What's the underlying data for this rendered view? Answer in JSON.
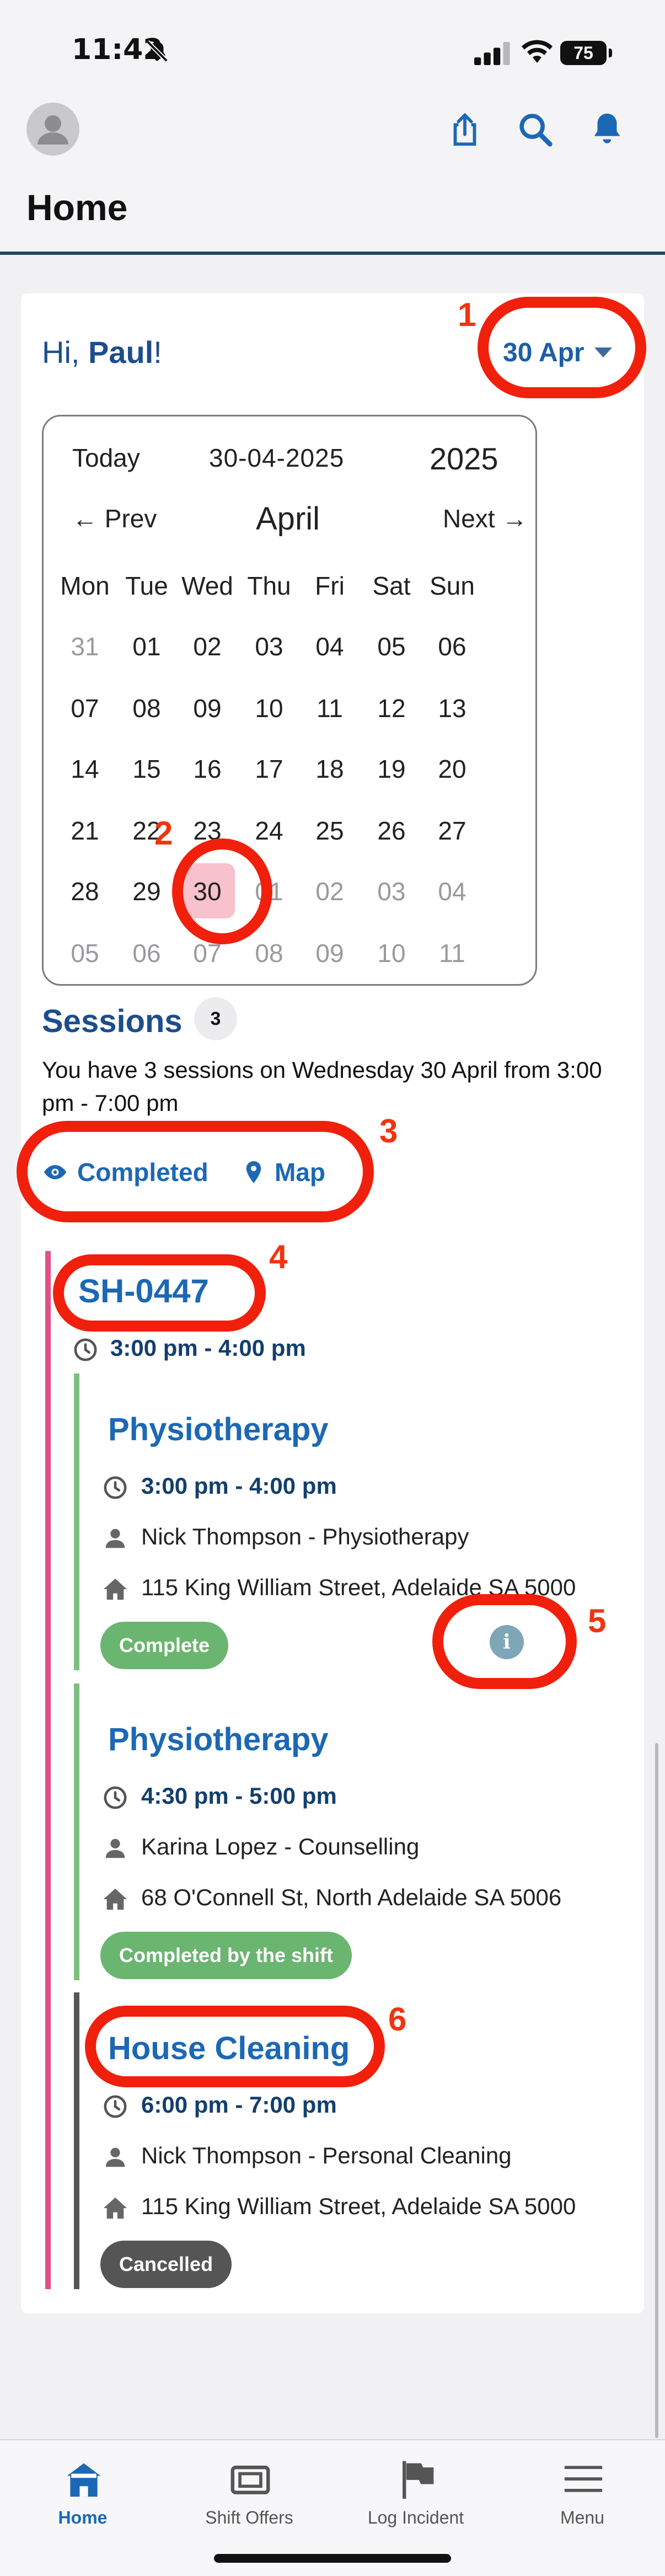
{
  "status_bar": {
    "time": "11:42",
    "battery": "75"
  },
  "header": {
    "title": "Home"
  },
  "greeting": {
    "prefix": "Hi, ",
    "name": "Paul",
    "suffix": "!"
  },
  "date_picker": {
    "label": "30 Apr"
  },
  "calendar": {
    "today_label": "Today",
    "date_string": "30-04-2025",
    "year": "2025",
    "prev_label": "← Prev",
    "month": "April",
    "next_label": "Next →",
    "weekdays": [
      "Mon",
      "Tue",
      "Wed",
      "Thu",
      "Fri",
      "Sat",
      "Sun"
    ],
    "weeks": [
      [
        "31",
        "01",
        "02",
        "03",
        "04",
        "05",
        "06"
      ],
      [
        "07",
        "08",
        "09",
        "10",
        "11",
        "12",
        "13"
      ],
      [
        "14",
        "15",
        "16",
        "17",
        "18",
        "19",
        "20"
      ],
      [
        "21",
        "22",
        "23",
        "24",
        "25",
        "26",
        "27"
      ],
      [
        "28",
        "29",
        "30",
        "01",
        "02",
        "03",
        "04"
      ],
      [
        "05",
        "06",
        "07",
        "08",
        "09",
        "10",
        "11"
      ]
    ],
    "selected_day": "30"
  },
  "sessions": {
    "title": "Sessions",
    "count": "3",
    "description": "You have 3 sessions on Wednesday 30 April from 3:00 pm - 7:00 pm",
    "completed_label": "Completed",
    "map_label": "Map"
  },
  "shift": {
    "id": "SH-0447",
    "time": "3:00 pm - 4:00 pm",
    "appointments": [
      {
        "title": "Physiotherapy",
        "time": "3:00 pm - 4:00 pm",
        "staff": "Nick Thompson - Physiotherapy",
        "address": "115 King William Street, Adelaide SA 5000",
        "status": "Complete",
        "bar_color": "#7cc07f",
        "badge_color": "#6ab56f"
      },
      {
        "title": "Physiotherapy",
        "time": "4:30 pm - 5:00 pm",
        "staff": "Karina Lopez - Counselling",
        "address": "68 O'Connell St, North Adelaide SA 5006",
        "status": "Completed by the shift",
        "bar_color": "#7cc07f",
        "badge_color": "#6ab56f"
      },
      {
        "title": "House Cleaning",
        "time": "6:00 pm - 7:00 pm",
        "staff": "Nick Thompson - Personal Cleaning",
        "address": "115 King William Street, Adelaide SA 5000",
        "status": "Cancelled",
        "bar_color": "#555555",
        "badge_color": "#555555"
      }
    ]
  },
  "annotations": [
    "1",
    "2",
    "3",
    "4",
    "5",
    "6"
  ],
  "bottom_nav": {
    "items": [
      {
        "label": "Home",
        "icon": "home-icon"
      },
      {
        "label": "Shift Offers",
        "icon": "ticket-icon"
      },
      {
        "label": "Log Incident",
        "icon": "flag-icon"
      },
      {
        "label": "Menu",
        "icon": "menu-icon"
      }
    ]
  },
  "colors": {
    "accent": "#1c68b5",
    "annotation": "#f0200c",
    "shift_bar": "#e34f86"
  }
}
